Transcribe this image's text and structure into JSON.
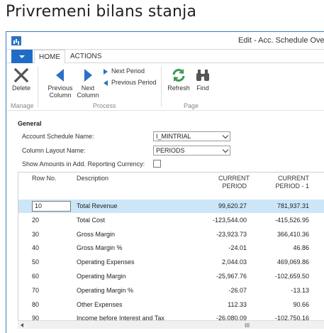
{
  "page_title": "Privremeni bilans stanja",
  "window": {
    "title": "Edit - Acc. Schedule Overview",
    "tabs": [
      {
        "label": "HOME"
      },
      {
        "label": "ACTIONS"
      }
    ]
  },
  "ribbon": {
    "manage": {
      "group_label": "Manage",
      "delete_label": "Delete"
    },
    "process": {
      "group_label": "Process",
      "previous_column_label": "Previous\nColumn",
      "next_column_label": "Next\nColumn",
      "next_period_label": "Next Period",
      "previous_period_label": "Previous Period"
    },
    "page": {
      "group_label": "Page",
      "refresh_label": "Refresh",
      "find_label": "Find"
    }
  },
  "general": {
    "section_label": "General",
    "account_schedule_name_label": "Account Schedule Name:",
    "account_schedule_name_value": "I_MINTRIAL",
    "column_layout_name_label": "Column Layout Name:",
    "column_layout_name_value": "PERIODS",
    "show_amounts_label": "Show Amounts in Add. Reporting Currency:"
  },
  "grid": {
    "headers": {
      "row_no": "Row No.",
      "description": "Description",
      "current_period_line1": "CURRENT",
      "current_period_line2": "PERIOD",
      "current_period_1_line1": "CURRENT",
      "current_period_1_line2": "PERIOD - 1"
    },
    "rows": [
      {
        "row_no": "10",
        "description": "Total Revenue",
        "current": "99,620.27",
        "prev": "781,937.31",
        "selected": true
      },
      {
        "row_no": "20",
        "description": "Total Cost",
        "current": "-123,544.00",
        "prev": "-415,526.95"
      },
      {
        "row_no": "30",
        "description": "Gross Margin",
        "current": "-23,923.73",
        "prev": "366,410.36"
      },
      {
        "row_no": "40",
        "description": "Gross Margin %",
        "current": "-24.01",
        "prev": "46.86"
      },
      {
        "row_no": "50",
        "description": "Operating Expenses",
        "current": "2,044.03",
        "prev": "469,069.86"
      },
      {
        "row_no": "60",
        "description": "Operating Margin",
        "current": "-25,967.76",
        "prev": "-102,659.50"
      },
      {
        "row_no": "70",
        "description": "Operating Margin %",
        "current": "-26.07",
        "prev": "-13.13"
      },
      {
        "row_no": "80",
        "description": "Other Expenses",
        "current": "112.33",
        "prev": "90.66"
      },
      {
        "row_no": "90",
        "description": "Income before Interest and Tax",
        "current": "-26,080.09",
        "prev": "-102,750.16"
      }
    ]
  },
  "scroll": {
    "thumb_glyph": "III"
  },
  "colors": {
    "accent": "#1f6cc4",
    "selected_row": "#cde6f7",
    "icon_blue": "#2c72c2",
    "icon_green": "#3a9b55"
  }
}
